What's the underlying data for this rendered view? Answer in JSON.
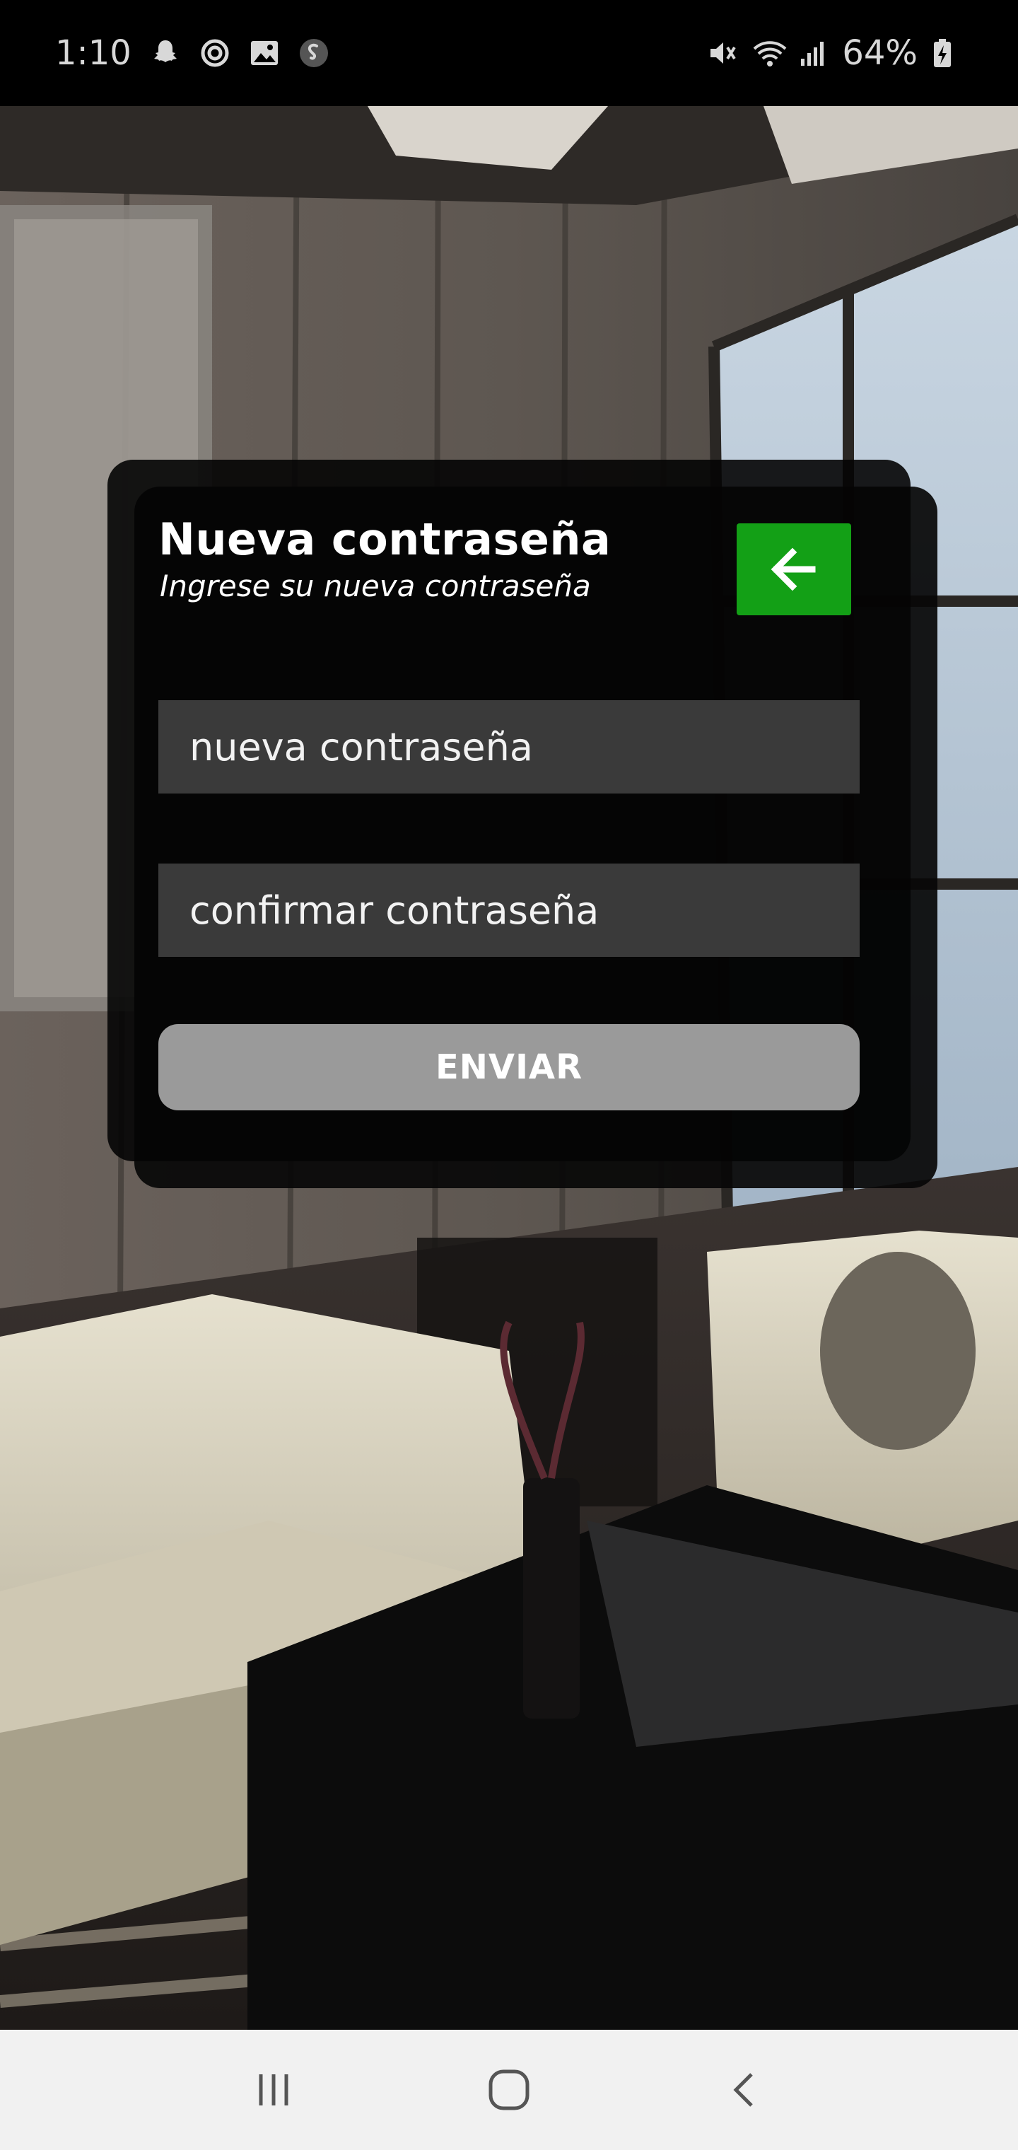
{
  "status_bar": {
    "time": "1:10",
    "battery": "64%",
    "left_icons": [
      "snapchat-icon",
      "sync-icon",
      "gallery-icon",
      "shazam-icon"
    ],
    "right_icons": [
      "mute-icon",
      "wifi-icon",
      "signal-icon",
      "battery-charging-icon"
    ]
  },
  "dialog": {
    "title": "Nueva contraseña",
    "subtitle": "Ingrese su nueva contraseña",
    "back_button_icon": "arrow-left-icon",
    "new_password_placeholder": "nueva contraseña",
    "confirm_password_placeholder": "confirmar contraseña",
    "send_label": "ENVIAR"
  },
  "nav_bar": {
    "items": [
      "recent-apps-icon",
      "home-icon",
      "back-icon"
    ]
  },
  "colors": {
    "accent_green": "#13a016",
    "dialog_bg": "#050505",
    "field_bg": "#3a3a3a",
    "send_button_bg": "#9a9a9a",
    "nav_bar_bg": "#f1f1f1"
  }
}
